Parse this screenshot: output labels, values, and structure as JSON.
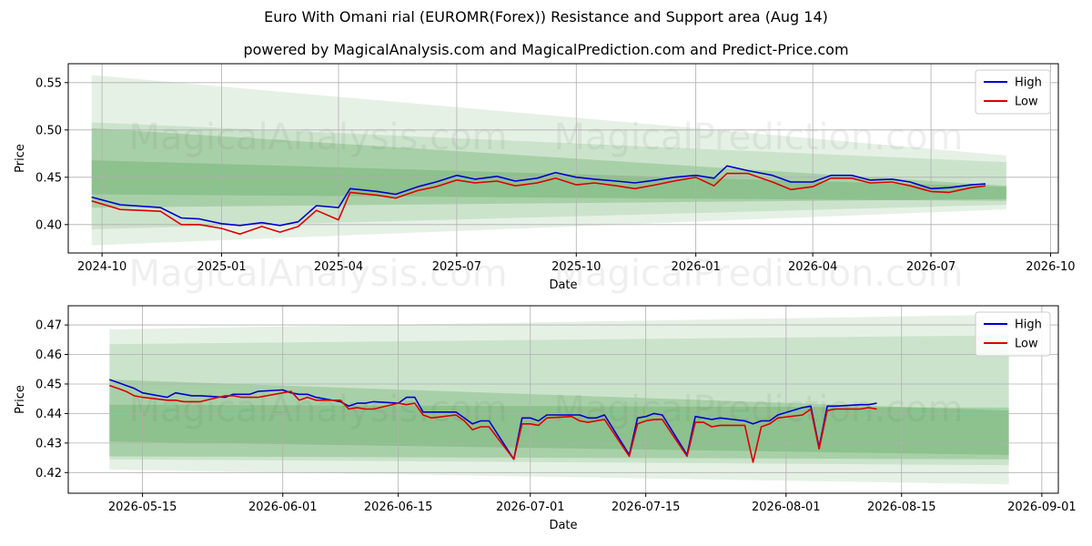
{
  "page": {
    "title": "Euro With Omani rial (EUROMR(Forex)) Resistance and Support area (Aug 14)",
    "subtitle": "powered by MagicalAnalysis.com and MagicalPrediction.com and Predict-Price.com",
    "watermark": "MagicalAnalysis.com    MagicalPrediction.com"
  },
  "colors": {
    "high": "#0000cc",
    "low": "#dd0000",
    "band": "#2e8b2e",
    "grid": "#b0b0b0"
  },
  "chart_data": [
    {
      "type": "line",
      "name": "overview",
      "xlabel": "Date",
      "ylabel": "Price",
      "xlim": [
        "2024-09-05",
        "2026-10-07"
      ],
      "ylim": [
        0.37,
        0.57
      ],
      "xticks": [
        "2024-10-01",
        "2025-01-01",
        "2025-04-01",
        "2025-07-01",
        "2025-10-01",
        "2026-01-01",
        "2026-04-01",
        "2026-07-01",
        "2026-10-01"
      ],
      "xtick_labels": [
        "2024-10",
        "2025-01",
        "2025-04",
        "2025-07",
        "2025-10",
        "2026-01",
        "2026-04",
        "2026-07",
        "2026-10"
      ],
      "yticks": [
        0.4,
        0.45,
        0.5,
        0.55
      ],
      "ytick_labels": [
        "0.40",
        "0.45",
        "0.50",
        "0.55"
      ],
      "grid": true,
      "legend": "top-right",
      "series": [
        {
          "name": "High",
          "x": [
            "2024-09-23",
            "2024-10-15",
            "2024-11-15",
            "2024-12-01",
            "2024-12-15",
            "2025-01-01",
            "2025-01-15",
            "2025-02-01",
            "2025-02-15",
            "2025-03-01",
            "2025-03-15",
            "2025-04-01",
            "2025-04-10",
            "2025-05-01",
            "2025-05-15",
            "2025-06-01",
            "2025-06-15",
            "2025-07-01",
            "2025-07-15",
            "2025-08-01",
            "2025-08-15",
            "2025-09-01",
            "2025-09-15",
            "2025-10-01",
            "2025-10-15",
            "2025-11-01",
            "2025-11-15",
            "2025-12-01",
            "2025-12-15",
            "2026-01-01",
            "2026-01-15",
            "2026-01-25",
            "2026-02-10",
            "2026-03-01",
            "2026-03-15",
            "2026-04-01",
            "2026-04-15",
            "2026-05-01",
            "2026-05-15",
            "2026-06-01",
            "2026-06-15",
            "2026-07-01",
            "2026-07-15",
            "2026-08-01",
            "2026-08-12"
          ],
          "values": [
            0.429,
            0.421,
            0.418,
            0.407,
            0.406,
            0.401,
            0.399,
            0.402,
            0.399,
            0.403,
            0.42,
            0.418,
            0.438,
            0.435,
            0.432,
            0.44,
            0.445,
            0.452,
            0.448,
            0.451,
            0.446,
            0.449,
            0.455,
            0.45,
            0.448,
            0.446,
            0.444,
            0.447,
            0.45,
            0.452,
            0.449,
            0.462,
            0.457,
            0.452,
            0.445,
            0.445,
            0.452,
            0.452,
            0.447,
            0.448,
            0.445,
            0.438,
            0.439,
            0.442,
            0.443
          ]
        },
        {
          "name": "Low",
          "x": [
            "2024-09-23",
            "2024-10-15",
            "2024-11-15",
            "2024-12-01",
            "2024-12-15",
            "2025-01-01",
            "2025-01-15",
            "2025-02-01",
            "2025-02-15",
            "2025-03-01",
            "2025-03-15",
            "2025-04-01",
            "2025-04-10",
            "2025-05-01",
            "2025-05-15",
            "2025-06-01",
            "2025-06-15",
            "2025-07-01",
            "2025-07-15",
            "2025-08-01",
            "2025-08-15",
            "2025-09-01",
            "2025-09-15",
            "2025-10-01",
            "2025-10-15",
            "2025-11-01",
            "2025-11-15",
            "2025-12-01",
            "2025-12-15",
            "2026-01-01",
            "2026-01-15",
            "2026-01-25",
            "2026-02-10",
            "2026-03-01",
            "2026-03-15",
            "2026-04-01",
            "2026-04-15",
            "2026-05-01",
            "2026-05-15",
            "2026-06-01",
            "2026-06-15",
            "2026-07-01",
            "2026-07-15",
            "2026-08-01",
            "2026-08-12"
          ],
          "values": [
            0.425,
            0.416,
            0.414,
            0.4,
            0.4,
            0.396,
            0.39,
            0.398,
            0.392,
            0.398,
            0.415,
            0.405,
            0.434,
            0.431,
            0.428,
            0.436,
            0.44,
            0.447,
            0.444,
            0.446,
            0.441,
            0.444,
            0.449,
            0.442,
            0.444,
            0.441,
            0.438,
            0.442,
            0.446,
            0.45,
            0.441,
            0.454,
            0.454,
            0.445,
            0.437,
            0.44,
            0.449,
            0.449,
            0.444,
            0.445,
            0.441,
            0.435,
            0.434,
            0.439,
            0.441
          ]
        }
      ],
      "bands": {
        "x_start": "2024-09-23",
        "x_end": "2026-08-28",
        "items": [
          {
            "top": [
              0.558,
              0.473
            ],
            "bottom": [
              0.378,
              0.416
            ],
            "opacity": 0.12
          },
          {
            "top": [
              0.508,
              0.466
            ],
            "bottom": [
              0.395,
              0.421
            ],
            "opacity": 0.14
          },
          {
            "top": [
              0.502,
              0.441
            ],
            "bottom": [
              0.432,
              0.425
            ],
            "opacity": 0.22
          },
          {
            "top": [
              0.468,
              0.44
            ],
            "bottom": [
              0.418,
              0.427
            ],
            "opacity": 0.22
          }
        ]
      }
    },
    {
      "type": "line",
      "name": "recent",
      "xlabel": "Date",
      "ylabel": "Price",
      "xlim": [
        "2026-05-06",
        "2026-09-03"
      ],
      "ylim": [
        0.413,
        0.4765
      ],
      "xticks": [
        "2026-05-15",
        "2026-06-01",
        "2026-06-15",
        "2026-07-01",
        "2026-07-15",
        "2026-08-01",
        "2026-08-15",
        "2026-09-01"
      ],
      "xtick_labels": [
        "2026-05-15",
        "2026-06-01",
        "2026-06-15",
        "2026-07-01",
        "2026-07-15",
        "2026-08-01",
        "2026-08-15",
        "2026-09-01"
      ],
      "yticks": [
        0.42,
        0.43,
        0.44,
        0.45,
        0.46,
        0.47
      ],
      "ytick_labels": [
        "0.42",
        "0.43",
        "0.44",
        "0.45",
        "0.46",
        "0.47"
      ],
      "grid": true,
      "legend": "top-right",
      "series": [
        {
          "name": "High",
          "x": [
            "2026-05-11",
            "2026-05-12",
            "2026-05-13",
            "2026-05-14",
            "2026-05-15",
            "2026-05-18",
            "2026-05-19",
            "2026-05-20",
            "2026-05-21",
            "2026-05-22",
            "2026-05-25",
            "2026-05-26",
            "2026-05-27",
            "2026-05-28",
            "2026-05-29",
            "2026-06-01",
            "2026-06-02",
            "2026-06-03",
            "2026-06-04",
            "2026-06-05",
            "2026-06-08",
            "2026-06-09",
            "2026-06-10",
            "2026-06-11",
            "2026-06-12",
            "2026-06-15",
            "2026-06-16",
            "2026-06-17",
            "2026-06-18",
            "2026-06-19",
            "2026-06-22",
            "2026-06-23",
            "2026-06-24",
            "2026-06-25",
            "2026-06-26",
            "2026-06-29",
            "2026-06-30",
            "2026-07-01",
            "2026-07-02",
            "2026-07-03",
            "2026-07-06",
            "2026-07-07",
            "2026-07-08",
            "2026-07-09",
            "2026-07-10",
            "2026-07-13",
            "2026-07-14",
            "2026-07-15",
            "2026-07-16",
            "2026-07-17",
            "2026-07-20",
            "2026-07-21",
            "2026-07-22",
            "2026-07-23",
            "2026-07-24",
            "2026-07-27",
            "2026-07-28",
            "2026-07-29",
            "2026-07-30",
            "2026-07-31",
            "2026-08-03",
            "2026-08-04",
            "2026-08-05",
            "2026-08-06",
            "2026-08-07",
            "2026-08-10",
            "2026-08-11",
            "2026-08-12"
          ],
          "values": [
            0.4515,
            0.4505,
            0.4495,
            0.4485,
            0.447,
            0.4455,
            0.447,
            0.4465,
            0.446,
            0.446,
            0.4455,
            0.4465,
            0.4465,
            0.4465,
            0.4475,
            0.448,
            0.447,
            0.4465,
            0.4465,
            0.4455,
            0.444,
            0.4425,
            0.4435,
            0.4435,
            0.444,
            0.4435,
            0.4455,
            0.4455,
            0.4405,
            0.4405,
            0.4405,
            0.4385,
            0.4365,
            0.4375,
            0.4375,
            0.4245,
            0.4385,
            0.4385,
            0.4375,
            0.4395,
            0.4395,
            0.4395,
            0.4385,
            0.4385,
            0.4395,
            0.426,
            0.4385,
            0.439,
            0.44,
            0.4395,
            0.426,
            0.439,
            0.4385,
            0.438,
            0.4385,
            0.4375,
            0.4365,
            0.4375,
            0.4375,
            0.4395,
            0.442,
            0.4425,
            0.4285,
            0.4425,
            0.4425,
            0.443,
            0.443,
            0.4435
          ]
        },
        {
          "name": "Low",
          "x": [
            "2026-05-11",
            "2026-05-12",
            "2026-05-13",
            "2026-05-14",
            "2026-05-15",
            "2026-05-18",
            "2026-05-19",
            "2026-05-20",
            "2026-05-21",
            "2026-05-22",
            "2026-05-25",
            "2026-05-26",
            "2026-05-27",
            "2026-05-28",
            "2026-05-29",
            "2026-06-01",
            "2026-06-02",
            "2026-06-03",
            "2026-06-04",
            "2026-06-05",
            "2026-06-08",
            "2026-06-09",
            "2026-06-10",
            "2026-06-11",
            "2026-06-12",
            "2026-06-15",
            "2026-06-16",
            "2026-06-17",
            "2026-06-18",
            "2026-06-19",
            "2026-06-22",
            "2026-06-23",
            "2026-06-24",
            "2026-06-25",
            "2026-06-26",
            "2026-06-29",
            "2026-06-30",
            "2026-07-01",
            "2026-07-02",
            "2026-07-03",
            "2026-07-06",
            "2026-07-07",
            "2026-07-08",
            "2026-07-09",
            "2026-07-10",
            "2026-07-13",
            "2026-07-14",
            "2026-07-15",
            "2026-07-16",
            "2026-07-17",
            "2026-07-20",
            "2026-07-21",
            "2026-07-22",
            "2026-07-23",
            "2026-07-24",
            "2026-07-27",
            "2026-07-28",
            "2026-07-29",
            "2026-07-30",
            "2026-07-31",
            "2026-08-03",
            "2026-08-04",
            "2026-08-05",
            "2026-08-06",
            "2026-08-07",
            "2026-08-10",
            "2026-08-11",
            "2026-08-12"
          ],
          "values": [
            0.4495,
            0.4485,
            0.4475,
            0.446,
            0.4455,
            0.4445,
            0.4445,
            0.444,
            0.444,
            0.444,
            0.446,
            0.446,
            0.4455,
            0.4455,
            0.4455,
            0.447,
            0.4475,
            0.4445,
            0.4455,
            0.4445,
            0.4445,
            0.4415,
            0.442,
            0.4415,
            0.4415,
            0.4435,
            0.443,
            0.4435,
            0.4395,
            0.4385,
            0.4395,
            0.4375,
            0.4345,
            0.4355,
            0.4355,
            0.4245,
            0.4365,
            0.4365,
            0.436,
            0.4385,
            0.439,
            0.4375,
            0.437,
            0.4375,
            0.438,
            0.4255,
            0.4365,
            0.4375,
            0.438,
            0.438,
            0.4255,
            0.437,
            0.437,
            0.4355,
            0.436,
            0.436,
            0.4235,
            0.4355,
            0.4365,
            0.4385,
            0.4395,
            0.4415,
            0.428,
            0.441,
            0.4415,
            0.4415,
            0.442,
            0.4415
          ]
        }
      ],
      "bands": {
        "x_start": "2026-05-11",
        "x_end": "2026-08-28",
        "items": [
          {
            "top": [
              0.4685,
              0.4735
            ],
            "bottom": [
              0.421,
              0.416
            ],
            "opacity": 0.12
          },
          {
            "top": [
              0.4635,
              0.4665
            ],
            "bottom": [
              0.4245,
              0.4225
            ],
            "opacity": 0.14
          },
          {
            "top": [
              0.4515,
              0.441
            ],
            "bottom": [
              0.4255,
              0.4245
            ],
            "opacity": 0.22
          },
          {
            "top": [
              0.443,
              0.442
            ],
            "bottom": [
              0.4305,
              0.426
            ],
            "opacity": 0.22
          }
        ]
      }
    }
  ]
}
